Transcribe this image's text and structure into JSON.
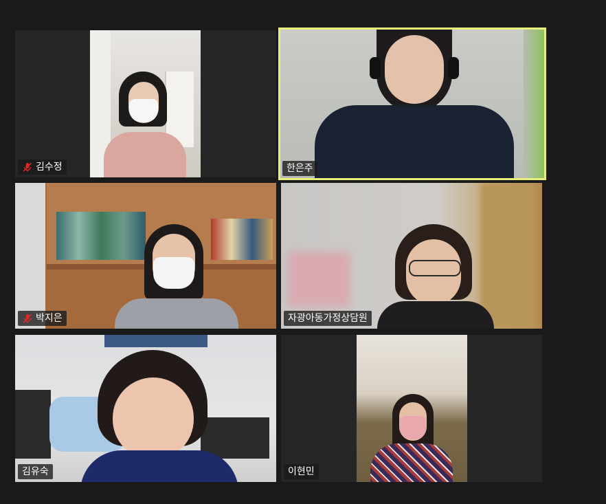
{
  "participants": [
    {
      "name": "김수정",
      "muted": true,
      "active": false
    },
    {
      "name": "한은주",
      "muted": false,
      "active": true
    },
    {
      "name": "박지은",
      "muted": true,
      "active": false
    },
    {
      "name": "자광아동가정상담원",
      "muted": false,
      "active": false
    },
    {
      "name": "김유숙",
      "muted": false,
      "active": false
    },
    {
      "name": "이현민",
      "muted": false,
      "active": false
    }
  ],
  "colors": {
    "background": "#1a1a1a",
    "tile": "#262626",
    "active_speaker_border": "#e6f07a",
    "muted_icon": "#e02828"
  },
  "icons": {
    "muted": "mic-muted-icon"
  }
}
